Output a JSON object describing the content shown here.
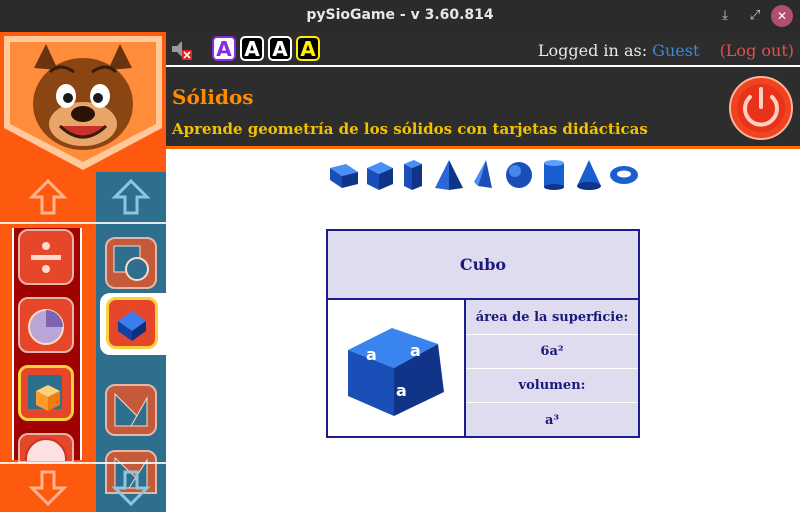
{
  "window": {
    "title": "pySioGame - v 3.60.814",
    "minimize_glyph": "⤓",
    "maximize_glyph": "⤢",
    "close_glyph": "✕"
  },
  "toolbar": {
    "font_buttons": [
      "A",
      "A",
      "A",
      "A"
    ],
    "login_prefix": "Logged in as: ",
    "user": "Guest",
    "logout": "(Log out)"
  },
  "header": {
    "title": "Sólidos",
    "subtitle": "Aprende geometría de los sólidos con tarjetas didácticas"
  },
  "shapes": [
    "triangular-prism",
    "cube",
    "cuboid",
    "pyramid",
    "tetrahedron",
    "sphere",
    "cylinder",
    "cone",
    "torus"
  ],
  "card": {
    "title": "Cubo",
    "rows": [
      "área de la superficie:",
      "6a²",
      "volumen:",
      "a³"
    ],
    "image_face_letter": "a"
  },
  "colors": {
    "accent_orange": "#fe5a0f",
    "sidebar_blue": "#2f6f8e",
    "header_title": "#ff8c00",
    "header_subtitle": "#f2c200",
    "card_text": "#1a1a7a",
    "card_bg": "#e0dcf0"
  }
}
